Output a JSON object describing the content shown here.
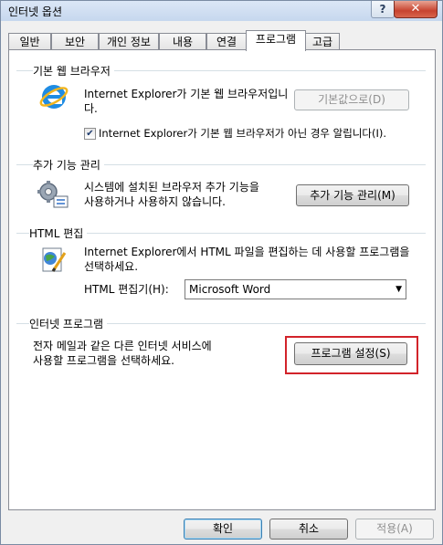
{
  "window": {
    "title": "인터넷 옵션",
    "help_label": "?",
    "close_label": "✕"
  },
  "tabs": [
    {
      "label": "일반"
    },
    {
      "label": "보안"
    },
    {
      "label": "개인 정보"
    },
    {
      "label": "내용"
    },
    {
      "label": "연결"
    },
    {
      "label": "프로그램",
      "active": true
    },
    {
      "label": "고급"
    }
  ],
  "default_browser": {
    "heading": "기본 웹 브라우저",
    "description": "Internet Explorer가 기본 웹 브라우저입니다.",
    "button_label": "기본값으로(D)",
    "checkbox_label": "Internet Explorer가 기본 웹 브라우저가 아닌 경우 알립니다(I).",
    "checkbox_checked": true,
    "icon": "internet-explorer-icon"
  },
  "addons": {
    "heading": "추가 기능 관리",
    "description_line1": "시스템에 설치된 브라우저 추가 기능을",
    "description_line2": "사용하거나 사용하지 않습니다.",
    "button_label": "추가 기능 관리(M)",
    "icon": "addons-gear-icon"
  },
  "html_editing": {
    "heading": "HTML 편집",
    "description_line1": "Internet Explorer에서 HTML 파일을 편집하는 데 사용할 프로그램을",
    "description_line2": "선택하세요.",
    "editor_label": "HTML 편집기(H):",
    "editor_value": "Microsoft Word",
    "icon": "html-edit-icon"
  },
  "internet_programs": {
    "heading": "인터넷 프로그램",
    "description_line1": "전자 메일과 같은 다른 인터넷 서비스에",
    "description_line2": "사용할 프로그램을 선택하세요.",
    "button_label": "프로그램 설정(S)",
    "highlight_color": "#d2232a"
  },
  "footer": {
    "ok_label": "확인",
    "cancel_label": "취소",
    "apply_label": "적용(A)"
  }
}
